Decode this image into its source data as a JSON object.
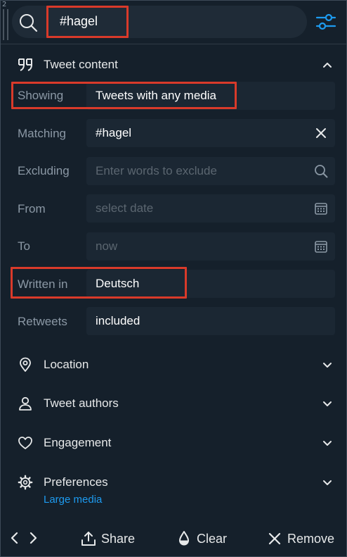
{
  "column_index": "2",
  "search": {
    "query": "#hagel"
  },
  "tweet_content": {
    "title": "Tweet content",
    "rows": {
      "showing": {
        "label": "Showing",
        "value": "Tweets with any media"
      },
      "matching": {
        "label": "Matching",
        "value": "#hagel"
      },
      "excluding": {
        "label": "Excluding",
        "placeholder": "Enter words to exclude"
      },
      "from": {
        "label": "From",
        "placeholder": "select date"
      },
      "to": {
        "label": "To",
        "placeholder": "now"
      },
      "written_in": {
        "label": "Written in",
        "value": "Deutsch"
      },
      "retweets": {
        "label": "Retweets",
        "value": "included"
      }
    }
  },
  "sections": {
    "location": "Location",
    "authors": "Tweet authors",
    "engagement": "Engagement",
    "preferences": {
      "label": "Preferences",
      "sublabel": "Large media"
    }
  },
  "footer": {
    "share": "Share",
    "clear": "Clear",
    "remove": "Remove"
  },
  "colors": {
    "accent": "#1d9bf0",
    "highlight": "#d93a2a",
    "background": "#15202b"
  }
}
